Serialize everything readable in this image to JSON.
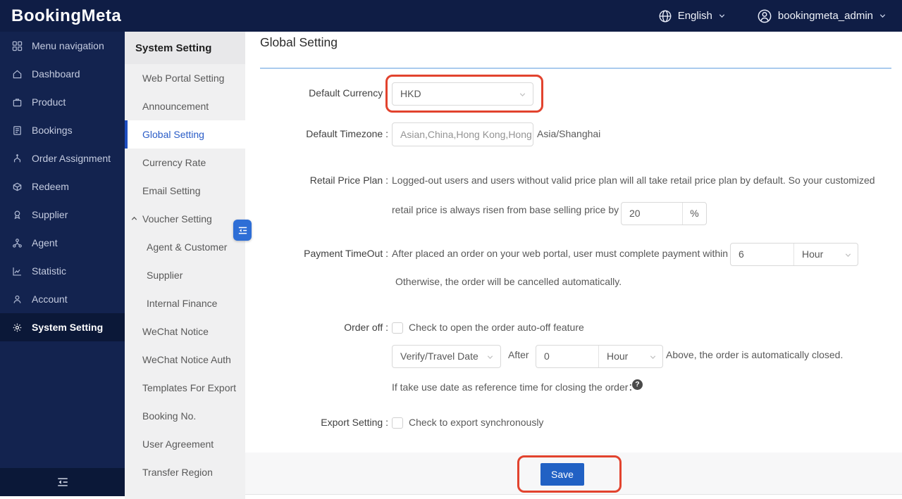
{
  "colors": {
    "navy_header": "#0f1d45",
    "navy_sidebar": "#13234f",
    "navy_active": "#0b1838",
    "accent_red": "#e2432e",
    "save_blue": "#2161c4",
    "active_link_blue": "#2a5cc7",
    "divider_blue": "#a9cbee"
  },
  "header": {
    "logo": "BookingMeta",
    "language": {
      "label": "English",
      "icon": "globe-icon"
    },
    "user": {
      "name": "bookingmeta_admin",
      "icon": "user-circle-icon"
    }
  },
  "sidebar": {
    "items": [
      {
        "label": "Menu navigation",
        "icon": "grid-icon"
      },
      {
        "label": "Dashboard",
        "icon": "home-icon"
      },
      {
        "label": "Product",
        "icon": "bag-icon"
      },
      {
        "label": "Bookings",
        "icon": "document-icon"
      },
      {
        "label": "Order Assignment",
        "icon": "branch-icon"
      },
      {
        "label": "Redeem",
        "icon": "box-icon"
      },
      {
        "label": "Supplier",
        "icon": "medal-icon"
      },
      {
        "label": "Agent",
        "icon": "network-icon"
      },
      {
        "label": "Statistic",
        "icon": "chart-icon"
      },
      {
        "label": "Account",
        "icon": "user-icon"
      },
      {
        "label": "System Setting",
        "icon": "gear-icon",
        "active": true
      }
    ],
    "collapse_icon": "menu-fold-icon"
  },
  "submenu": {
    "title": "System Setting",
    "items": [
      {
        "label": "Web Portal Setting"
      },
      {
        "label": "Announcement"
      },
      {
        "label": "Global Setting",
        "active": true
      },
      {
        "label": "Currency Rate"
      },
      {
        "label": "Email Setting"
      },
      {
        "label": "Voucher Setting",
        "expanded": true
      },
      {
        "label": "Agent & Customer",
        "sub": true
      },
      {
        "label": "Supplier",
        "sub": true
      },
      {
        "label": "Internal Finance",
        "sub": true
      },
      {
        "label": "WeChat Notice"
      },
      {
        "label": "WeChat Notice Auth"
      },
      {
        "label": "Templates For Export"
      },
      {
        "label": "Booking No."
      },
      {
        "label": "User Agreement"
      },
      {
        "label": "Transfer Region"
      }
    ],
    "collapse_icon": "menu-fold-icon"
  },
  "main": {
    "title": "Global Setting",
    "currency": {
      "label": "Default Currency :",
      "value": "HKD"
    },
    "timezone": {
      "label": "Default Timezone :",
      "value": "Asian,China,Hong Kong,Hong",
      "note": "Asia/Shanghai"
    },
    "retail": {
      "label": "Retail Price Plan :",
      "line1": "Logged-out users and users without valid price plan will all take retail price plan by default. So your customized",
      "line2": "retail price is always risen from base selling price by",
      "value": "20",
      "suffix": "%"
    },
    "payment": {
      "label": "Payment TimeOut :",
      "line1": "After placed an order on your web portal, user must complete payment within",
      "value": "6",
      "unit": "Hour",
      "line2": "Otherwise, the order will be cancelled automatically."
    },
    "order_off": {
      "label": "Order off :",
      "checkbox_label": "Check to open the order auto-off feature",
      "date_option": "Verify/Travel Date",
      "after": "After",
      "value": "0",
      "unit": "Hour",
      "tail": "Above, the order is automatically closed.",
      "hint": "If take use date as reference time for closing the order：",
      "help": "?"
    },
    "export": {
      "label": "Export Setting :",
      "checkbox_label": "Check to export synchronously"
    },
    "save_label": "Save"
  }
}
